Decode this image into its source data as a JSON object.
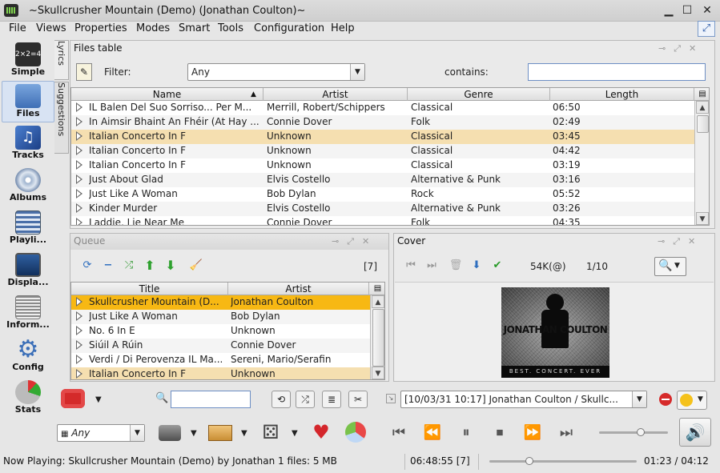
{
  "window": {
    "title": "~Skullcrusher Mountain (Demo) (Jonathan Coulton)~",
    "minimize": "▁",
    "maximize": "☐",
    "close": "✕"
  },
  "menu": [
    "File",
    "Views",
    "Properties",
    "Modes",
    "Smart",
    "Tools",
    "Configuration",
    "Help"
  ],
  "sidebar": [
    {
      "label": "Simple",
      "icon": "simple-view-icon"
    },
    {
      "label": "Files",
      "icon": "folder-icon"
    },
    {
      "label": "Tracks",
      "icon": "music-note-icon"
    },
    {
      "label": "Albums",
      "icon": "cd-icon"
    },
    {
      "label": "Playli...",
      "icon": "playlist-icon"
    },
    {
      "label": "Displa...",
      "icon": "display-icon"
    },
    {
      "label": "Inform...",
      "icon": "information-icon"
    },
    {
      "label": "Config",
      "icon": "gear-icon"
    },
    {
      "label": "Stats",
      "icon": "pie-chart-icon"
    }
  ],
  "side_tabs": {
    "lyrics": "Lyrics",
    "suggestions": "Suggestions"
  },
  "files_table": {
    "title": "Files table",
    "filter_label": "Filter:",
    "filter_value": "Any",
    "contains_label": "contains:",
    "contains_value": "",
    "columns": [
      "Name",
      "Artist",
      "Genre",
      "Length"
    ],
    "rows": [
      {
        "name": "IL Balen Del Suo Sorriso... Per M...",
        "artist": "Merrill, Robert/Schippers",
        "genre": "Classical",
        "length": "06:50",
        "selected": false
      },
      {
        "name": "In Aimsir Bhaint An Fhéir (At Hay ...",
        "artist": "Connie Dover",
        "genre": "Folk",
        "length": "02:49",
        "selected": false
      },
      {
        "name": "Italian Concerto In F",
        "artist": "Unknown",
        "genre": "Classical",
        "length": "03:45",
        "selected": true
      },
      {
        "name": "Italian Concerto In F",
        "artist": "Unknown",
        "genre": "Classical",
        "length": "04:42",
        "selected": false
      },
      {
        "name": "Italian Concerto In F",
        "artist": "Unknown",
        "genre": "Classical",
        "length": "03:19",
        "selected": false
      },
      {
        "name": "Just About Glad",
        "artist": "Elvis Costello",
        "genre": "Alternative & Punk",
        "length": "03:16",
        "selected": false
      },
      {
        "name": "Just Like A Woman",
        "artist": "Bob Dylan",
        "genre": "Rock",
        "length": "05:52",
        "selected": false
      },
      {
        "name": "Kinder Murder",
        "artist": "Elvis Costello",
        "genre": "Alternative & Punk",
        "length": "03:26",
        "selected": false
      },
      {
        "name": "Laddie, Lie Near Me",
        "artist": "Connie Dover",
        "genre": "Folk",
        "length": "04:35",
        "selected": false
      }
    ]
  },
  "queue": {
    "title": "Queue",
    "count": "[7]",
    "columns": [
      "Title",
      "Artist"
    ],
    "rows": [
      {
        "title": "Skullcrusher Mountain (D...",
        "artist": "Jonathan Coulton",
        "state": "playing"
      },
      {
        "title": "Just Like A Woman",
        "artist": "Bob Dylan",
        "state": ""
      },
      {
        "title": "No. 6 In E",
        "artist": "Unknown",
        "state": ""
      },
      {
        "title": "Siúil A Rúin",
        "artist": "Connie Dover",
        "state": ""
      },
      {
        "title": "Verdi / Di Perovenza IL Ma...",
        "artist": "Sereni, Mario/Serafin",
        "state": ""
      },
      {
        "title": "Italian Concerto In F",
        "artist": "Unknown",
        "state": "selected"
      }
    ]
  },
  "cover": {
    "title": "Cover",
    "size": "54K(@)",
    "index": "1/10",
    "artist_text": "JONATHAN COULTON",
    "album_text": "BEST. CONCERT. EVER"
  },
  "search": {
    "value": ""
  },
  "history_value": "[10/03/31 10:17] Jonathan Coulton / Skullc...",
  "ambience_value": "Any",
  "volume_level": 0.6,
  "seek_fraction": 0.27,
  "status": {
    "now_playing": "Now Playing:  Skullcrusher Mountain (Demo) by Jonathan Coult",
    "files": "1 files: 5 MB",
    "total": "06:48:55 [7]",
    "time": "01:23 / 04:12"
  }
}
